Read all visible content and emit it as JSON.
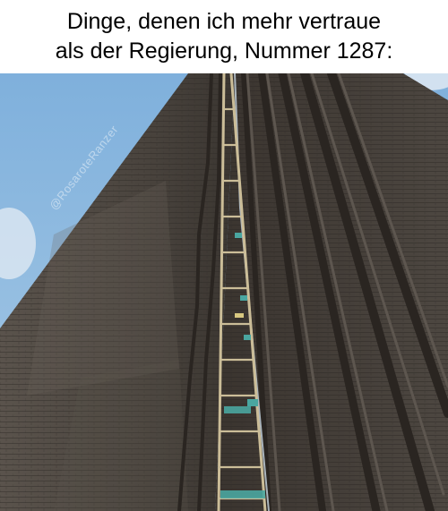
{
  "caption": {
    "line1": "Dinge, denen ich mehr vertraue",
    "line2": "als der Regierung, Nummer 1287:"
  },
  "photo": {
    "watermark": "@RosaroteRanzer",
    "colors": {
      "sky": "#8fb9dd",
      "brick_dark": "#3f3934",
      "brick_mid": "#56504a",
      "ladder": "#c8b894",
      "rope": "#4aa6a0"
    }
  }
}
